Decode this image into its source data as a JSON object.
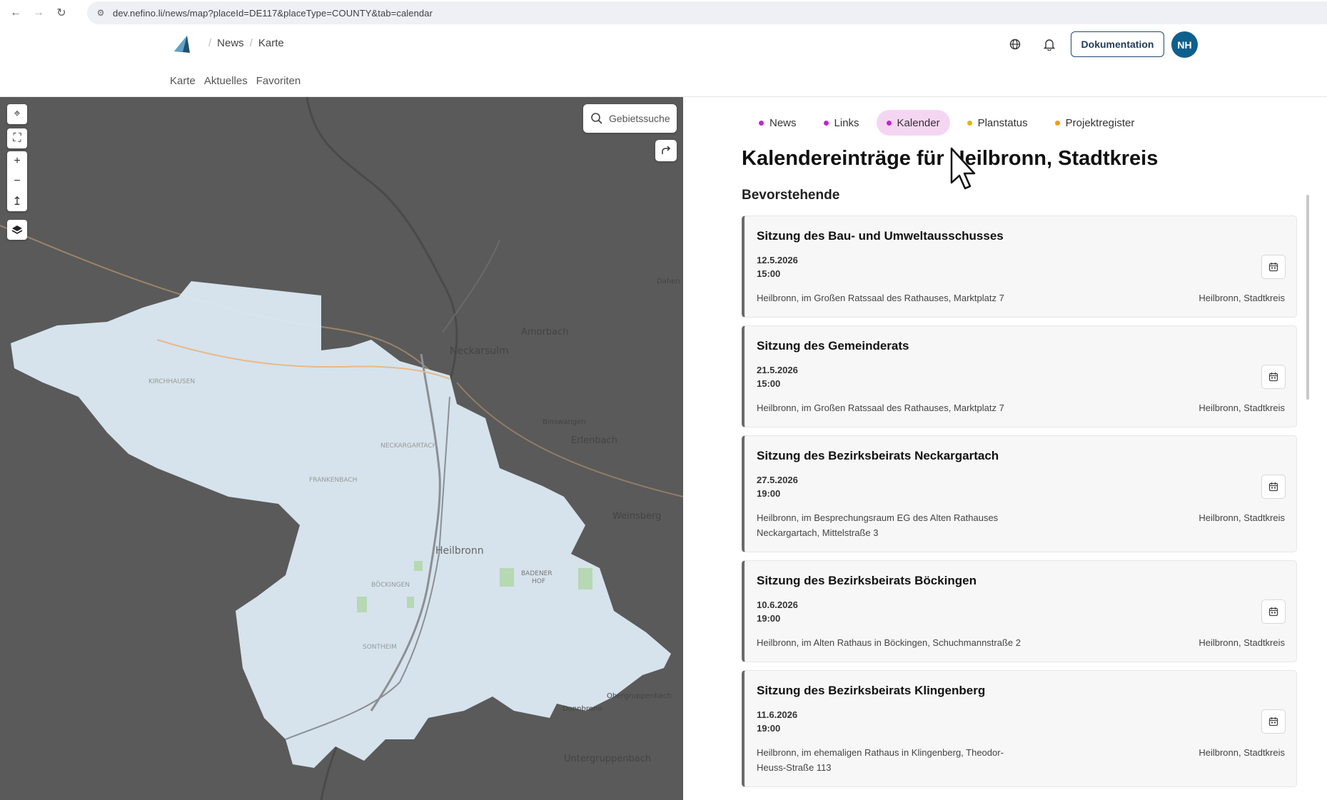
{
  "browser": {
    "url": "dev.nefino.li/news/map?placeId=DE117&placeType=COUNTY&tab=calendar"
  },
  "header": {
    "breadcrumb": [
      "News",
      "Karte"
    ],
    "doc_button": "Dokumentation",
    "avatar_initials": "NH",
    "subnav": [
      "Karte",
      "Aktuelles",
      "Favoriten"
    ]
  },
  "map": {
    "search_label": "Gebietssuche",
    "place_labels": [
      "Amorbach",
      "Neckarsulm",
      "Erlenbach",
      "Weinsberg",
      "Heilbronn",
      "BADENER",
      "HOF",
      "NECKARGARTACH",
      "FRANKENBACH",
      "KIRCHHAUSEN",
      "BÖCKINGEN",
      "SONTHEIM",
      "Untergruppenbach",
      "Binswangen",
      "Obergruppenbach",
      "Donnbronn",
      "Dahen"
    ]
  },
  "tabs": [
    {
      "label": "News",
      "color": "#c026d3",
      "active": false
    },
    {
      "label": "Links",
      "color": "#c026d3",
      "active": false
    },
    {
      "label": "Kalender",
      "color": "#c026d3",
      "active": true
    },
    {
      "label": "Planstatus",
      "color": "#eab308",
      "active": false
    },
    {
      "label": "Projektregister",
      "color": "#f59e0b",
      "active": false
    }
  ],
  "panel": {
    "title": "Kalendereinträge für Heilbronn, Stadtkreis",
    "section": "Bevorstehende"
  },
  "events": [
    {
      "title": "Sitzung des Bau- und Umweltausschusses",
      "date": "12.5.2026",
      "time": "15:00",
      "location": "Heilbronn, im Großen Ratssaal des Rathauses, Marktplatz 7",
      "region": "Heilbronn, Stadtkreis"
    },
    {
      "title": "Sitzung des Gemeinderats",
      "date": "21.5.2026",
      "time": "15:00",
      "location": "Heilbronn, im Großen Ratssaal des Rathauses, Marktplatz 7",
      "region": "Heilbronn, Stadtkreis"
    },
    {
      "title": "Sitzung des Bezirksbeirats Neckargartach",
      "date": "27.5.2026",
      "time": "19:00",
      "location": "Heilbronn, im Besprechungsraum EG des Alten Rathauses Neckargartach, Mittelstraße 3",
      "region": "Heilbronn, Stadtkreis"
    },
    {
      "title": "Sitzung des Bezirksbeirats Böckingen",
      "date": "10.6.2026",
      "time": "19:00",
      "location": "Heilbronn, im Alten Rathaus in Böckingen, Schuchmannstraße 2",
      "region": "Heilbronn, Stadtkreis"
    },
    {
      "title": "Sitzung des Bezirksbeirats Klingenberg",
      "date": "11.6.2026",
      "time": "19:00",
      "location": "Heilbronn, im ehemaligen Rathaus in Klingenberg, Theodor-Heuss-Straße 113",
      "region": "Heilbronn, Stadtkreis"
    }
  ]
}
